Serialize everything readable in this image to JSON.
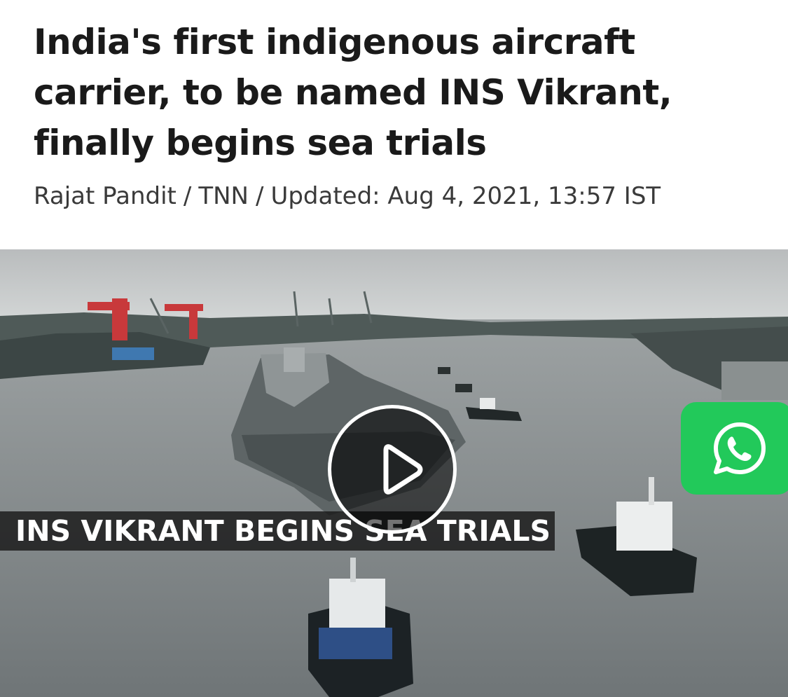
{
  "article": {
    "headline": "India's first indigenous aircraft carrier, to be named INS Vikrant, finally begins sea trials",
    "byline": {
      "author": "Rajat Pandit",
      "separator": "/",
      "source": "TNN",
      "updated": "Updated: Aug 4, 2021, 13:57 IST"
    }
  },
  "video": {
    "caption": "INS VIKRANT BEGINS SEA TRIALS",
    "play_icon": "play-icon"
  },
  "share": {
    "icon": "whatsapp-icon",
    "color": "#22c95a"
  }
}
